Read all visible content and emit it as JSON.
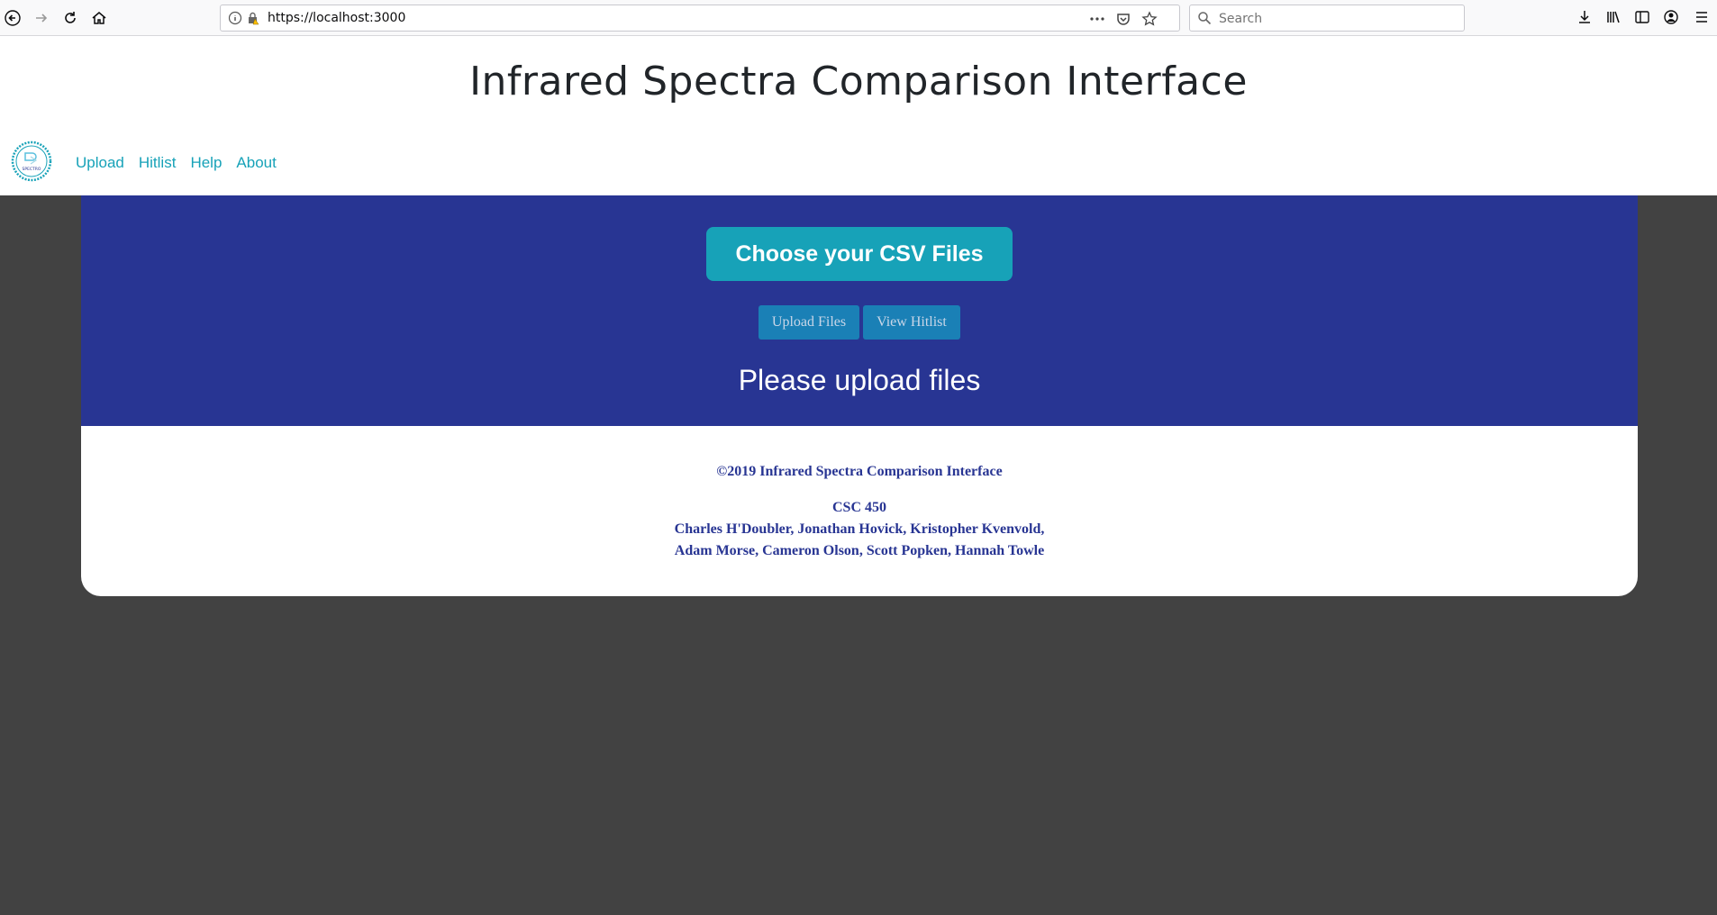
{
  "browser": {
    "url": "https://localhost:3000",
    "search_placeholder": "Search"
  },
  "header": {
    "title": "Infrared Spectra Comparison Interface",
    "logo_text": "SPECTRO",
    "nav": [
      {
        "label": "Upload"
      },
      {
        "label": "Hitlist"
      },
      {
        "label": "Help"
      },
      {
        "label": "About"
      }
    ]
  },
  "main": {
    "choose_button": "Choose your CSV Files",
    "upload_button": "Upload Files",
    "hitlist_button": "View Hitlist",
    "status": "Please upload files"
  },
  "footer": {
    "copyright": "©2019 Infrared Spectra Comparison Interface",
    "course": "CSC 450",
    "authors_line1": "Charles H'Doubler, Jonathan Hovick, Kristopher Kvenvold,",
    "authors_line2": "Adam Morse, Cameron Olson, Scott Popken, Hannah Towle"
  },
  "colors": {
    "accent": "#17a2b8",
    "hero_bg": "#283593",
    "page_bg": "#424242"
  }
}
